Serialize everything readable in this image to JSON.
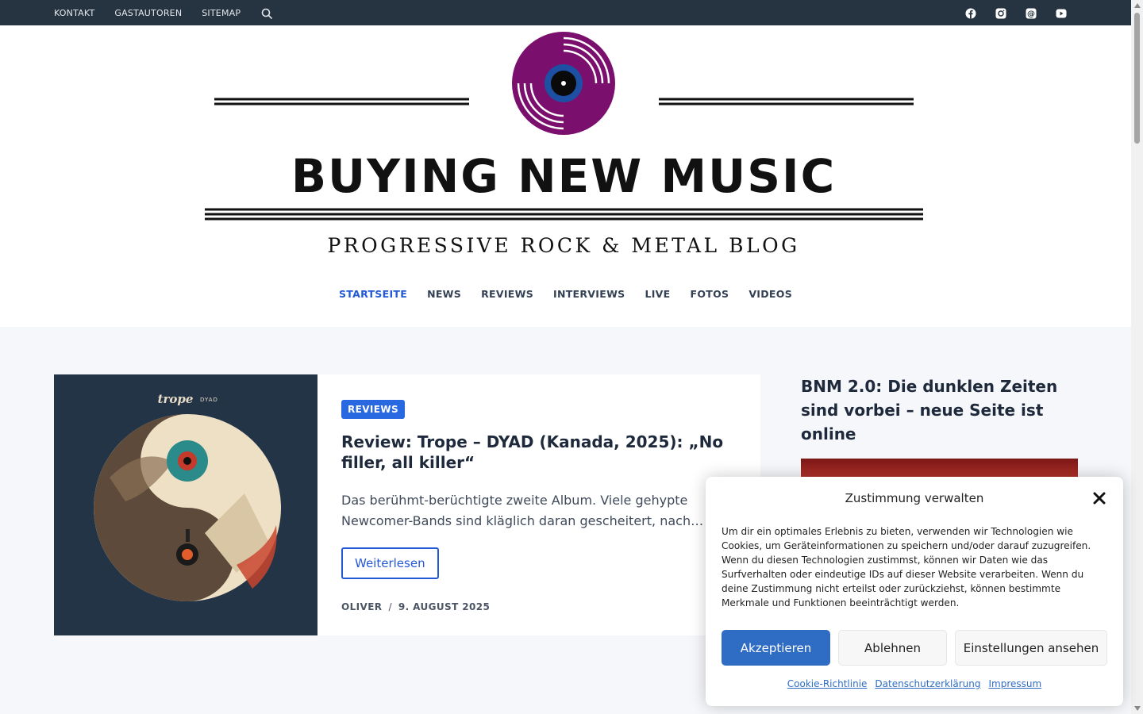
{
  "topbar": {
    "links": [
      "KONTAKT",
      "GASTAUTOREN",
      "SITEMAP"
    ],
    "search_icon": "search-icon",
    "social_icons": [
      "facebook-icon",
      "instagram-icon",
      "threads-icon",
      "youtube-icon"
    ]
  },
  "logo": {
    "title": "BUYING NEW MUSIC",
    "subtitle": "PROGRESSIVE ROCK & METAL BLOG"
  },
  "nav": {
    "items": [
      "STARTSEITE",
      "NEWS",
      "REVIEWS",
      "INTERVIEWS",
      "LIVE",
      "FOTOS",
      "VIDEOS"
    ],
    "active": "STARTSEITE"
  },
  "post": {
    "category": "REVIEWS",
    "title": "Review: Trope – DYAD (Kanada, 2025): „No filler, all killer“",
    "excerpt": "Das berühmt-berüchtigte zweite Album. Viele gehypte Newcomer-Bands sind kläglich daran gescheitert, nach…",
    "read_more": "Weiterlesen",
    "author": "OLIVER",
    "separator": "/",
    "date": "9. AUGUST 2025",
    "image_band": "trope",
    "image_album": "DYAD"
  },
  "sidebar": {
    "title": "BNM 2.0: Die dunklen Zeiten sind vorbei – neue Seite ist online"
  },
  "cookie": {
    "title": "Zustimmung verwalten",
    "text": "Um dir ein optimales Erlebnis zu bieten, verwenden wir Technologien wie Cookies, um Geräteinformationen zu speichern und/oder darauf zuzugreifen. Wenn du diesen Technologien zustimmst, können wir Daten wie das Surfverhalten oder eindeutige IDs auf dieser Website verarbeiten. Wenn du deine Zustimmung nicht erteilst oder zurückziehst, können bestimmte Merkmale und Funktionen beeinträchtigt werden.",
    "accept": "Akzeptieren",
    "deny": "Ablehnen",
    "settings": "Einstellungen ansehen",
    "links": [
      "Cookie-Richtlinie",
      "Datenschutzerklärung",
      "Impressum"
    ]
  },
  "colors": {
    "topbar": "#263442",
    "accent": "#2358d6",
    "vinyl": "#7b0f6e",
    "accept_button": "#2f6cc4"
  }
}
